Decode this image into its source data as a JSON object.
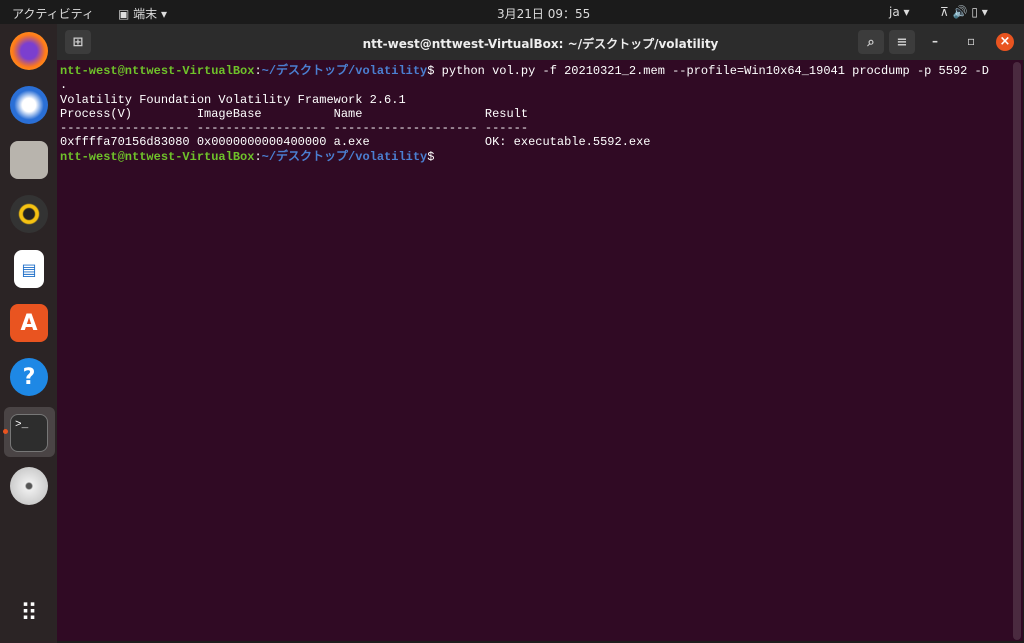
{
  "topbar": {
    "activities": "アクティビティ",
    "app": "端末",
    "app_chevron": "▾",
    "clock": "3月21日 09：55",
    "lang": "ja ▾",
    "tray": "⊼ 🔊 ▯ ▾"
  },
  "window": {
    "title": "ntt-west@nttwest-VirtualBox: ~/デスクトップ/volatility",
    "newtab": "⊞",
    "search": "⌕",
    "menu": "≡",
    "minimize": "–",
    "maximize": "▫",
    "close": "×"
  },
  "terminal": {
    "user": "ntt-west@nttwest-VirtualBox",
    "path": "~/デスクトップ/volatility",
    "command": "python vol.py -f 20210321_2.mem --profile=Win10x64_19041 procdump -p 5592 -D",
    "wrap": ".",
    "lines": [
      "Volatility Foundation Volatility Framework 2.6.1",
      "Process(V)         ImageBase          Name                 Result",
      "------------------ ------------------ -------------------- ------",
      "0xffffa70156d83080 0x0000000000400000 a.exe                OK: executable.5592.exe"
    ]
  },
  "dock": [
    "firefox",
    "thunderbird",
    "files",
    "rhythmbox",
    "writer",
    "software",
    "help",
    "terminal",
    "dvd",
    "apps"
  ]
}
